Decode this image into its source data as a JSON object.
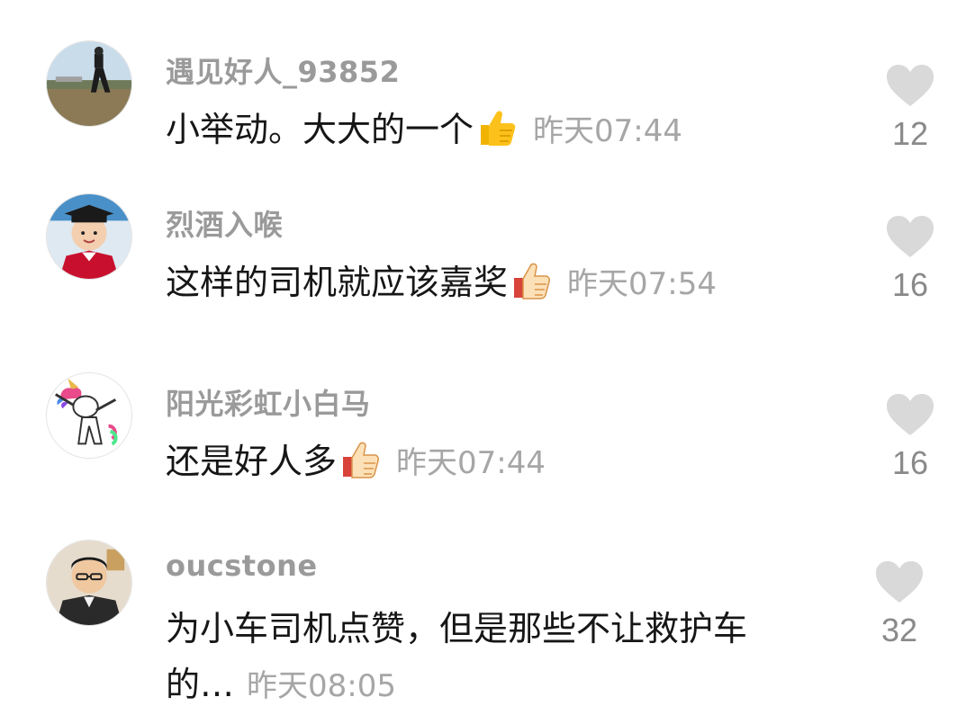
{
  "colors": {
    "username": "#9a9a9a",
    "content": "#161616",
    "timestamp": "#a6a6a6",
    "heart": "#d9d9d9",
    "like_count": "#8a8a8a"
  },
  "comments": [
    {
      "username": "遇见好人_93852",
      "text": "小举动。大大的一个",
      "emoji": "thumbs-up-icon",
      "time": "昨天07:44",
      "likes": "12"
    },
    {
      "username": "烈酒入喉",
      "text": "这样的司机就应该嘉奖",
      "emoji": "thumbs-up-icon",
      "time": "昨天07:54",
      "likes": "16"
    },
    {
      "username": "阳光彩虹小白马",
      "text": "还是好人多",
      "emoji": "thumbs-up-icon",
      "time": "昨天07:44",
      "likes": "16"
    },
    {
      "username": "oucstone",
      "text": "为小车司机点赞，但是那些不让救护车的…",
      "time": "昨天08:05",
      "likes": "32"
    }
  ]
}
